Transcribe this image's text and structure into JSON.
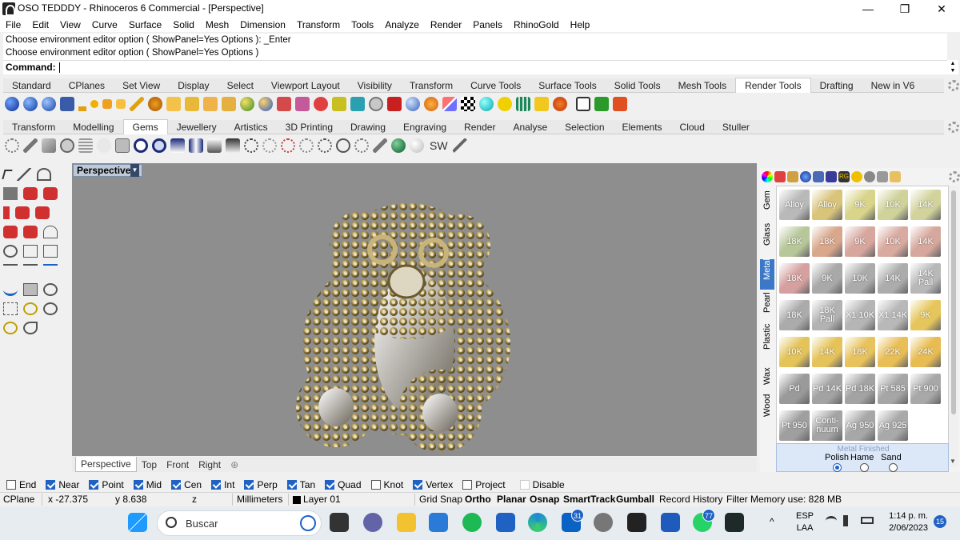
{
  "window": {
    "title": "OSO TEDDDY - Rhinoceros 6 Commercial - [Perspective]",
    "minimize": "—",
    "maximize": "❐",
    "close": "✕"
  },
  "menu": [
    "File",
    "Edit",
    "View",
    "Curve",
    "Surface",
    "Solid",
    "Mesh",
    "Dimension",
    "Transform",
    "Tools",
    "Analyze",
    "Render",
    "Panels",
    "RhinoGold",
    "Help"
  ],
  "command": {
    "history": [
      "Choose environment editor option ( ShowPanel=Yes  Options ): _Enter",
      "Choose environment editor option ( ShowPanel=Yes  Options )"
    ],
    "prompt": "Command:",
    "value": ""
  },
  "toolbar_tabs_1": [
    "Standard",
    "CPlanes",
    "Set View",
    "Display",
    "Select",
    "Viewport Layout",
    "Visibility",
    "Transform",
    "Curve Tools",
    "Surface Tools",
    "Solid Tools",
    "Mesh Tools",
    "Render Tools",
    "Drafting",
    "New in V6"
  ],
  "toolbar_tabs_1_active": "Render Tools",
  "toolbar_tabs_2": [
    "Transform",
    "Modelling",
    "Gems",
    "Jewellery",
    "Artistics",
    "3D Printing",
    "Drawing",
    "Engraving",
    "Render",
    "Analyse",
    "Selection",
    "Elements",
    "Cloud",
    "Stuller"
  ],
  "toolbar_tabs_2_active": "Gems",
  "sw_label": "SW",
  "viewport": {
    "name": "Perspective",
    "tabs": [
      "Perspective",
      "Top",
      "Front",
      "Right"
    ],
    "active_tab": "Perspective",
    "add_tab": "⊕"
  },
  "material_panel": {
    "vertical_tabs": [
      "Gem",
      "Glass",
      "Metal",
      "Pearl",
      "Plastic",
      "Wax",
      "Wood"
    ],
    "active_tab": "Metal",
    "swatches": [
      {
        "label": "Alloy",
        "color": "#b9b9b9"
      },
      {
        "label": "Alloy",
        "color": "#d9c47a"
      },
      {
        "label": "9K",
        "color": "#d8d48a"
      },
      {
        "label": "10K",
        "color": "#cfd39a"
      },
      {
        "label": "14K",
        "color": "#d2d39c"
      },
      {
        "label": "18K",
        "color": "#b7c79a"
      },
      {
        "label": "18K",
        "color": "#d9a78c"
      },
      {
        "label": "9K",
        "color": "#d7a79e"
      },
      {
        "label": "10K",
        "color": "#d8aaa0"
      },
      {
        "label": "14K",
        "color": "#d6a79c"
      },
      {
        "label": "18K",
        "color": "#d6a0a0"
      },
      {
        "label": "9K",
        "color": "#a9a9a9"
      },
      {
        "label": "10K",
        "color": "#ababab"
      },
      {
        "label": "14K",
        "color": "#acacac"
      },
      {
        "label": "14K Pall",
        "color": "#b8b8b8"
      },
      {
        "label": "18K",
        "color": "#ababab"
      },
      {
        "label": "18K Pall",
        "color": "#b2b2b2"
      },
      {
        "label": "X1 10K",
        "color": "#b5b5b5"
      },
      {
        "label": "X1 14K",
        "color": "#b8b8b8"
      },
      {
        "label": "9K",
        "color": "#e6c65c"
      },
      {
        "label": "10K",
        "color": "#e4c35a"
      },
      {
        "label": "14K",
        "color": "#e6c35a"
      },
      {
        "label": "18K",
        "color": "#e8c25c"
      },
      {
        "label": "22K",
        "color": "#e9be56"
      },
      {
        "label": "24K",
        "color": "#e8bc52"
      },
      {
        "label": "Pd",
        "color": "#9a9a9a"
      },
      {
        "label": "Pd 14K",
        "color": "#a3a3a3"
      },
      {
        "label": "Pd 18K",
        "color": "#a3a3a3"
      },
      {
        "label": "Pt 585",
        "color": "#a6a6a6"
      },
      {
        "label": "Pt 900",
        "color": "#a8a8a8"
      },
      {
        "label": "Pt 950",
        "color": "#9f9f9f"
      },
      {
        "label": "Conti-nuum",
        "color": "#a4a4a4"
      },
      {
        "label": "Ag 950",
        "color": "#a7a7a7"
      },
      {
        "label": "Ag 925",
        "color": "#a9a9a9"
      }
    ],
    "finish_title": "Metal Finished",
    "finish_options": [
      "Polish",
      "Hame",
      "Sand"
    ],
    "finish_selected": "Polish"
  },
  "osnaps": [
    {
      "label": "End",
      "checked": false
    },
    {
      "label": "Near",
      "checked": true
    },
    {
      "label": "Point",
      "checked": true
    },
    {
      "label": "Mid",
      "checked": true
    },
    {
      "label": "Cen",
      "checked": true
    },
    {
      "label": "Int",
      "checked": true
    },
    {
      "label": "Perp",
      "checked": true
    },
    {
      "label": "Tan",
      "checked": true
    },
    {
      "label": "Quad",
      "checked": true
    },
    {
      "label": "Knot",
      "checked": false
    },
    {
      "label": "Vertex",
      "checked": true
    },
    {
      "label": "Project",
      "checked": false
    },
    {
      "label": "Disable",
      "checked": false
    }
  ],
  "status": {
    "cplane": "CPlane",
    "x": "x -27.375",
    "y": "y 8.638",
    "z": "z",
    "units": "Millimeters",
    "layer": "Layer 01",
    "grid_snap": "Grid Snap",
    "ortho": "Ortho",
    "planar": "Planar",
    "osnap": "Osnap",
    "smarttrack": "SmartTrack",
    "gumball": "Gumball",
    "record_history": "Record History",
    "filter": "Filter",
    "memory": "Memory use: 828 MB"
  },
  "taskbar": {
    "search_placeholder": "Buscar",
    "badge_outlook": "31",
    "badge_whatsapp": "77",
    "lang_1": "ESP",
    "lang_2": "LAA",
    "time": "1:14 p. m.",
    "date": "2/06/2023",
    "notif_count": "15"
  }
}
